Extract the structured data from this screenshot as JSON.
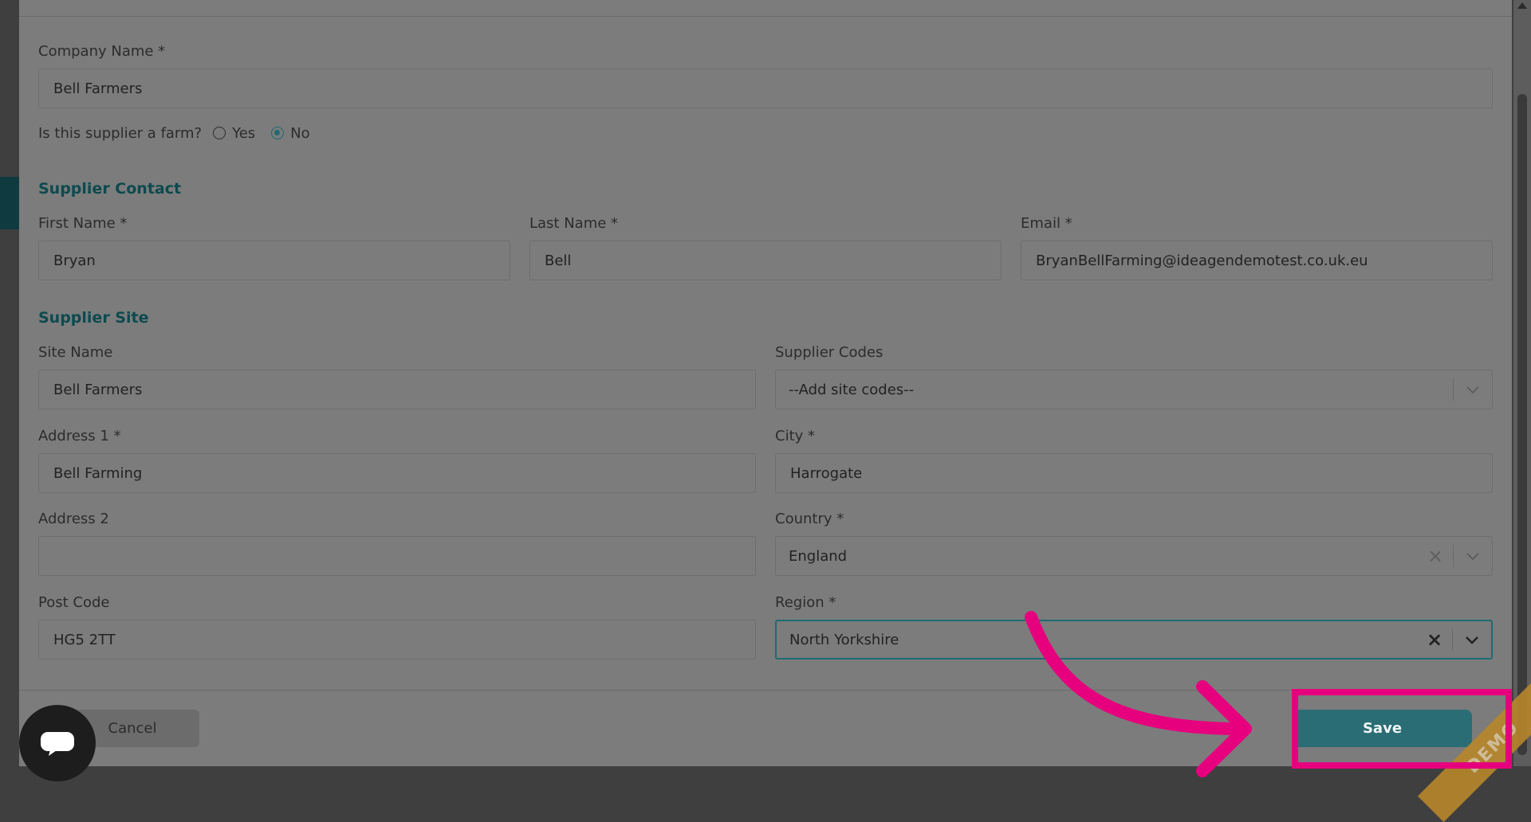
{
  "form": {
    "company_name_label": "Company Name *",
    "company_name_value": "Bell Farmers",
    "farm_question": "Is this supplier a farm?",
    "farm_options": [
      {
        "label": "Yes",
        "checked": false
      },
      {
        "label": "No",
        "checked": true
      }
    ],
    "supplier_contact_title": "Supplier Contact",
    "first_name_label": "First Name *",
    "first_name_value": "Bryan",
    "last_name_label": "Last Name *",
    "last_name_value": "Bell",
    "email_label": "Email *",
    "email_value": "BryanBellFarming@ideagendemotest.co.uk.eu",
    "supplier_site_title": "Supplier Site",
    "site_name_label": "Site Name",
    "site_name_value": "Bell Farmers",
    "supplier_codes_label": "Supplier Codes",
    "supplier_codes_placeholder": "--Add site codes--",
    "address1_label": "Address 1 *",
    "address1_value": "Bell Farming",
    "city_label": "City *",
    "city_value": "Harrogate",
    "address2_label": "Address 2",
    "address2_value": "",
    "country_label": "Country *",
    "country_value": "England",
    "post_code_label": "Post Code",
    "post_code_value": "HG5 2TT",
    "region_label": "Region *",
    "region_value": "North Yorkshire"
  },
  "footer": {
    "cancel_label": "Cancel",
    "save_label": "Save"
  },
  "overlay": {
    "ribbon_text": "DEMO",
    "highlight_color": "#e6007e",
    "accent_color": "#2a6d75"
  }
}
